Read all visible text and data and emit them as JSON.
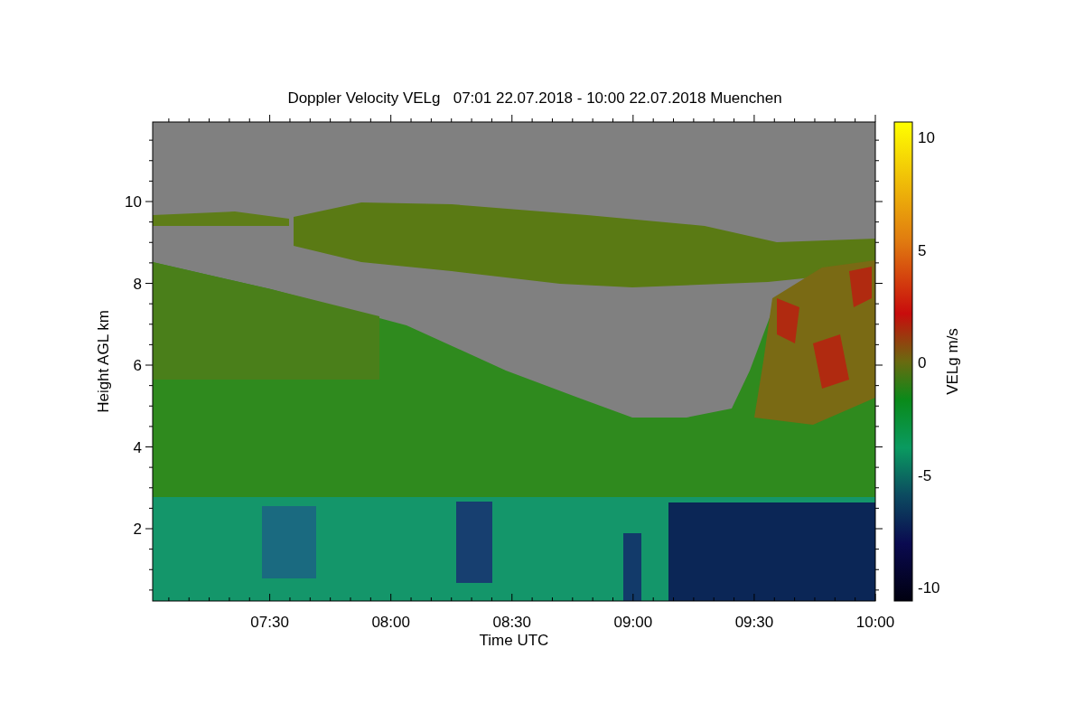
{
  "title": "Doppler Velocity VELg   07:01 22.07.2018 - 10:00 22.07.2018 Muenchen",
  "x_axis": {
    "label": "Time UTC",
    "tick_labels": [
      "07:30",
      "08:00",
      "08:30",
      "09:00",
      "09:30",
      "10:00"
    ]
  },
  "y_axis": {
    "label": "Height AGL km",
    "tick_labels": [
      "10",
      "8",
      "6",
      "4",
      "2"
    ]
  },
  "colorbar": {
    "label": "VELg m/s",
    "tick_labels": [
      "10",
      "5",
      "0",
      "-5",
      "-10"
    ]
  }
}
